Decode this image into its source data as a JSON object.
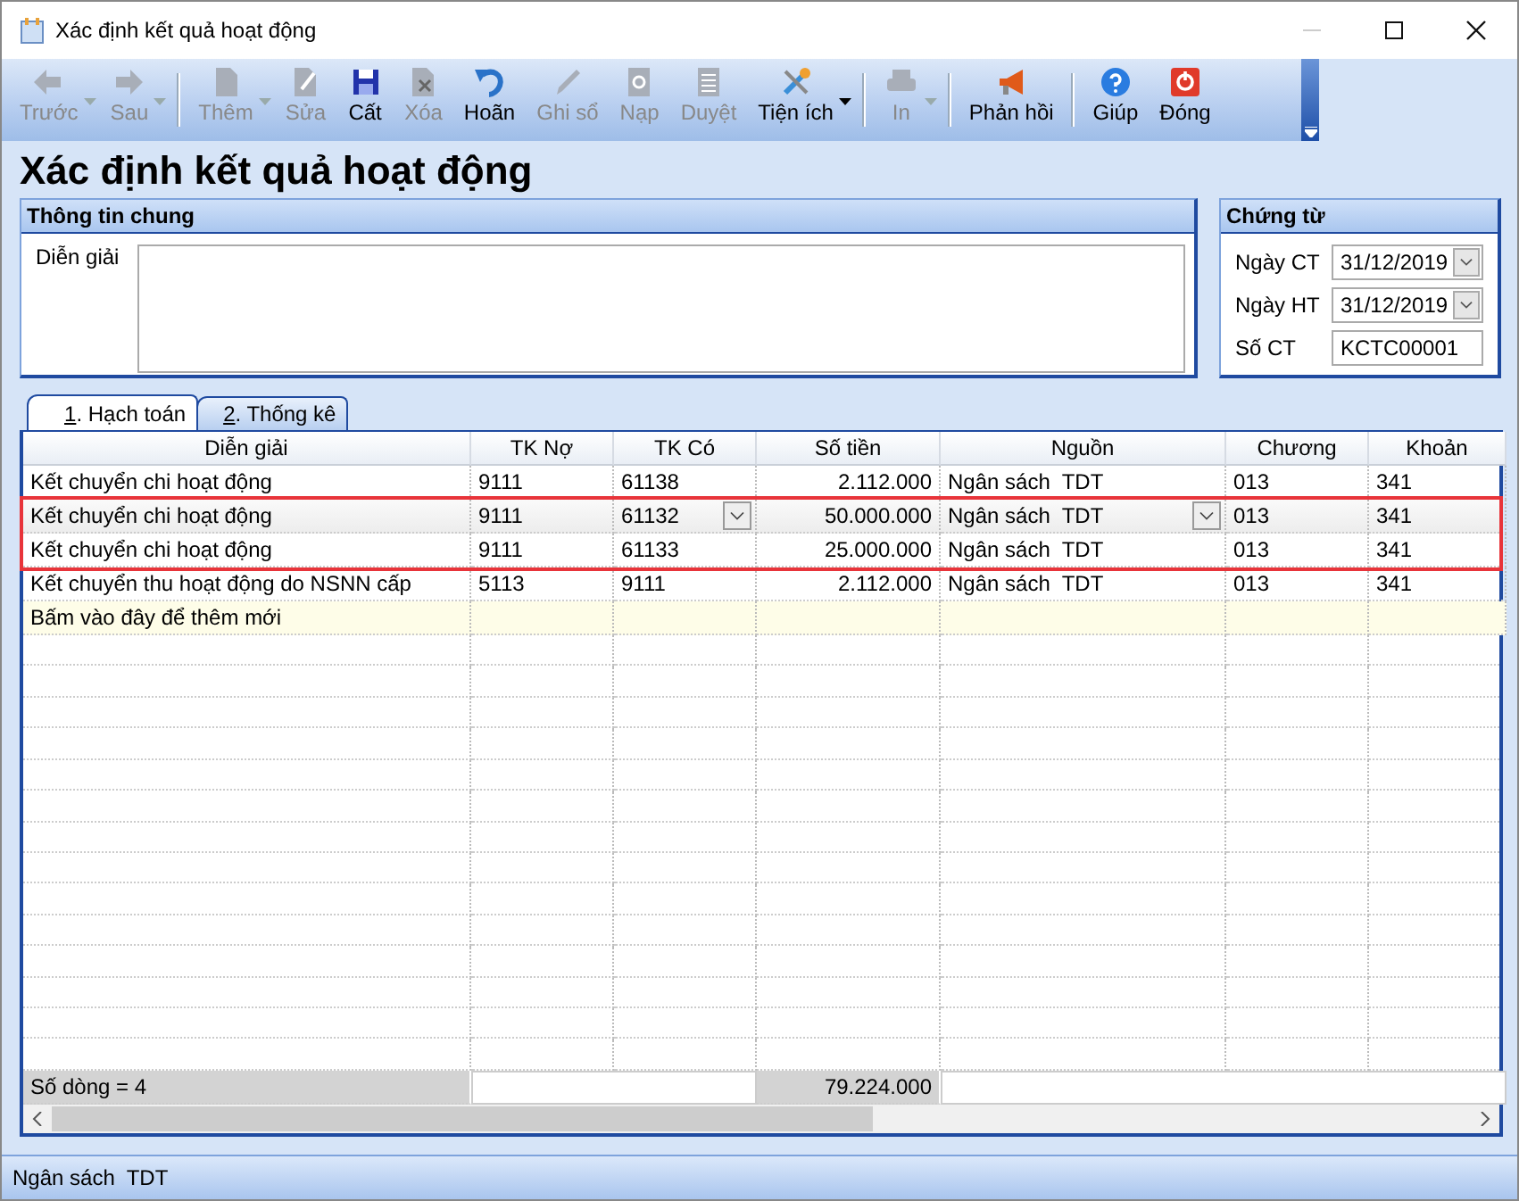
{
  "window": {
    "title": "Xác định kết quả hoạt động"
  },
  "toolbar": [
    {
      "label": "Trước",
      "disabled": true,
      "menu": true
    },
    {
      "label": "Sau",
      "disabled": true,
      "menu": true
    },
    {
      "label": "Thêm",
      "disabled": true,
      "menu": true
    },
    {
      "label": "Sửa",
      "disabled": true,
      "menu": false
    },
    {
      "label": "Cất",
      "disabled": false,
      "menu": false
    },
    {
      "label": "Xóa",
      "disabled": true,
      "menu": false
    },
    {
      "label": "Hoãn",
      "disabled": false,
      "menu": false
    },
    {
      "label": "Ghi sổ",
      "disabled": true,
      "menu": false
    },
    {
      "label": "Nạp",
      "disabled": true,
      "menu": false
    },
    {
      "label": "Duyệt",
      "disabled": true,
      "menu": false
    },
    {
      "label": "Tiện ích",
      "disabled": false,
      "menu": true
    },
    {
      "label": "In",
      "disabled": true,
      "menu": true
    },
    {
      "label": "Phản hồi",
      "disabled": false,
      "menu": false
    },
    {
      "label": "Giúp",
      "disabled": false,
      "menu": false
    },
    {
      "label": "Đóng",
      "disabled": false,
      "menu": false
    }
  ],
  "page_title": "Xác định kết quả hoạt động",
  "general": {
    "title": "Thông tin chung",
    "fields": [
      {
        "label": "Diễn giải"
      }
    ]
  },
  "voucher": {
    "title": "Chứng từ",
    "fields": [
      {
        "label": "Ngày CT",
        "value": "31/12/2019",
        "kind": "date"
      },
      {
        "label": "Ngày HT",
        "value": "31/12/2019",
        "kind": "date"
      },
      {
        "label": "Số CT",
        "value": "KCTC00001",
        "kind": "text"
      }
    ]
  },
  "tabs": [
    {
      "label": "1. Hạch toán",
      "selected": true
    },
    {
      "label": "2. Thống kê",
      "selected": false
    }
  ],
  "table": {
    "columns": [
      {
        "label": "Diễn giải",
        "kind": "text"
      },
      {
        "label": "TK Nợ",
        "kind": "text"
      },
      {
        "label": "TK Có",
        "kind": "combo"
      },
      {
        "label": "Số tiền",
        "kind": "number"
      },
      {
        "label": "Nguồn",
        "kind": "combo"
      },
      {
        "label": "Chương",
        "kind": "text"
      },
      {
        "label": "Khoản",
        "kind": "text"
      }
    ],
    "rows": [
      {
        "cells": [
          "Kết chuyển chi hoạt động",
          "9111",
          "61138",
          "2.112.000",
          "Ngân sách  TDT",
          "013",
          "341"
        ],
        "highlighted": false,
        "editing": false
      },
      {
        "cells": [
          "Kết chuyển chi hoạt động",
          "9111",
          "61132",
          "50.000.000",
          "Ngân sách  TDT",
          "013",
          "341"
        ],
        "highlighted": true,
        "editing": true
      },
      {
        "cells": [
          "Kết chuyển chi hoạt động",
          "9111",
          "61133",
          "25.000.000",
          "Ngân sách  TDT",
          "013",
          "341"
        ],
        "highlighted": true,
        "editing": false
      },
      {
        "cells": [
          "Kết chuyển thu hoạt động do NSNN cấp",
          "5113",
          "9111",
          "2.112.000",
          "Ngân sách  TDT",
          "013",
          "341"
        ],
        "highlighted": false,
        "editing": false
      }
    ],
    "new_row": "Bấm vào đây để thêm mới",
    "footer": {
      "count": "Số dòng = 4",
      "total": "79.224.000"
    }
  },
  "status_bar": "Ngân sách  TDT"
}
